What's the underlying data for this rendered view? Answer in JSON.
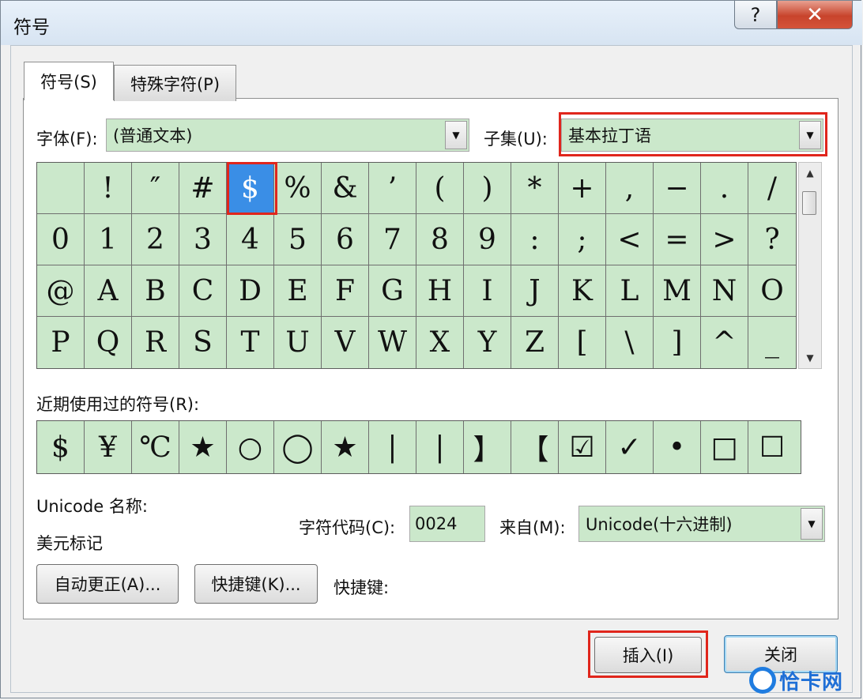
{
  "window": {
    "title": "符号",
    "help_label": "?",
    "close_label": "✕"
  },
  "tabs": [
    {
      "label": "符号(S)"
    },
    {
      "label": "特殊字符(P)"
    }
  ],
  "font": {
    "label": "字体(F):",
    "value": "(普通文本)"
  },
  "subset": {
    "label": "子集(U):",
    "value": "基本拉丁语"
  },
  "symbol_grid": [
    [
      "",
      "!",
      "″",
      "#",
      "$",
      "%",
      "&",
      "’",
      "(",
      ")",
      "*",
      "+",
      ",",
      "−",
      ".",
      "/"
    ],
    [
      "0",
      "1",
      "2",
      "3",
      "4",
      "5",
      "6",
      "7",
      "8",
      "9",
      ":",
      ";",
      "<",
      "=",
      ">",
      "?"
    ],
    [
      "@",
      "A",
      "B",
      "C",
      "D",
      "E",
      "F",
      "G",
      "H",
      "I",
      "J",
      "K",
      "L",
      "M",
      "N",
      "O"
    ],
    [
      "P",
      "Q",
      "R",
      "S",
      "T",
      "U",
      "V",
      "W",
      "X",
      "Y",
      "Z",
      "[",
      "\\",
      "]",
      "^",
      "_"
    ]
  ],
  "selected_symbol": "$",
  "recent": {
    "label": "近期使用过的符号(R):",
    "symbols": [
      "$",
      "¥",
      "℃",
      "★",
      "○",
      "◯",
      "★",
      "|",
      "|",
      "】",
      "【",
      "☑",
      "✓",
      "•",
      "□",
      "☐"
    ]
  },
  "unicode_name": {
    "label": "Unicode 名称:",
    "value": "美元标记"
  },
  "char_code": {
    "label": "字符代码(C):",
    "value": "0024"
  },
  "from": {
    "label": "来自(M):",
    "value": "Unicode(十六进制)"
  },
  "buttons": {
    "autocorrect": "自动更正(A)...",
    "shortcut_key": "快捷键(K)...",
    "shortcut_label": "快捷键:",
    "insert": "插入(I)",
    "close": "关闭"
  },
  "watermark": "恰卡网",
  "colors": {
    "cell_bg": "#cbe8cb",
    "selected": "#3a8ee6",
    "highlight": "#e0261c"
  }
}
